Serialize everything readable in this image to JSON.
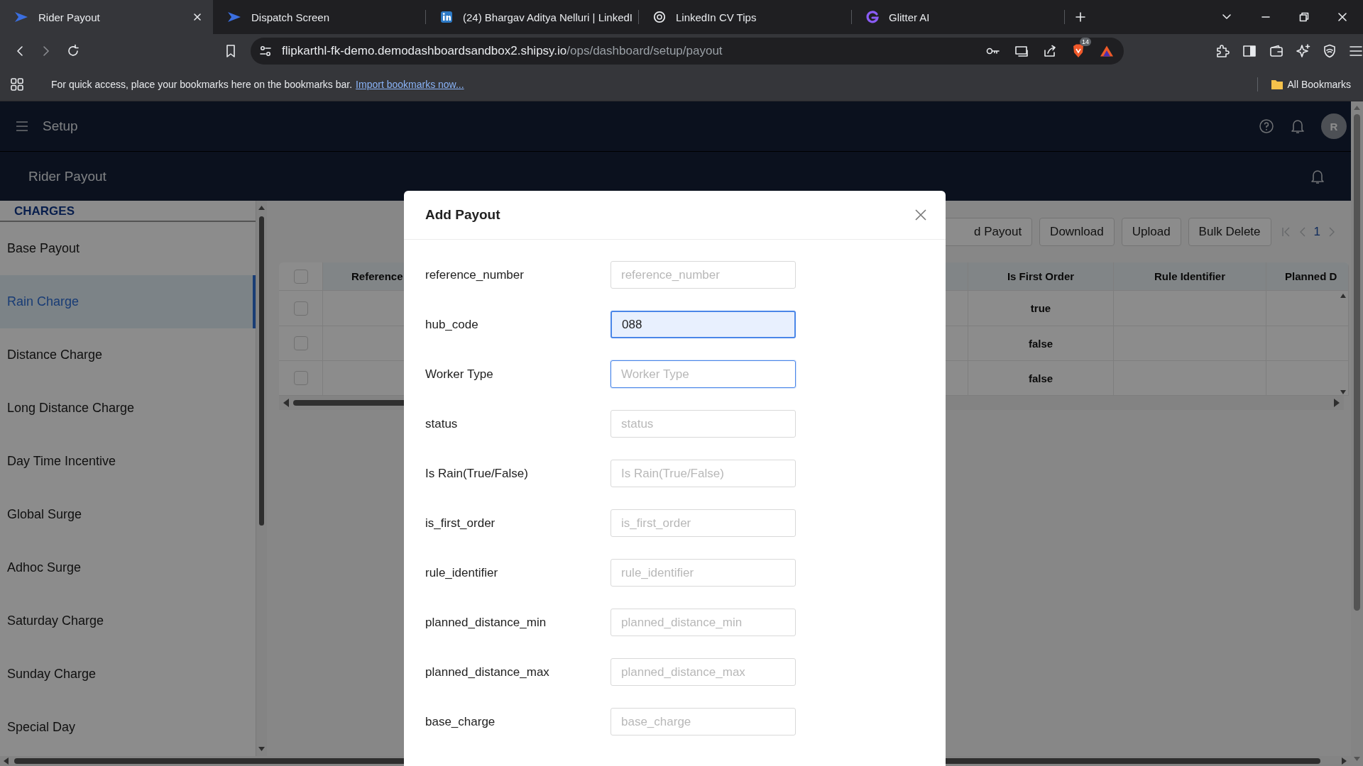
{
  "browser": {
    "tabs": [
      {
        "title": "Rider Payout",
        "kind": "shipsy",
        "selected": true
      },
      {
        "title": "Dispatch Screen",
        "kind": "shipsy",
        "selected": false
      },
      {
        "title": "(24) Bhargav Aditya Nelluri | LinkedI",
        "kind": "linkedin",
        "selected": false
      },
      {
        "title": "LinkedIn CV Tips",
        "kind": "globe",
        "selected": false
      },
      {
        "title": "Glitter AI",
        "kind": "glitter",
        "selected": false
      }
    ],
    "url": {
      "host": "flipkarthl-fk-demo.demodashboardsandbox2.shipsy.io",
      "path": "/ops/dashboard/setup/payout"
    },
    "extension_badge": "14",
    "bookmarks_bar": {
      "message": "For quick access, place your bookmarks here on the bookmarks bar.",
      "link": "Import bookmarks now...",
      "all_bookmarks": "All Bookmarks"
    }
  },
  "app": {
    "header_title": "Setup",
    "avatar": "R",
    "page_title": "Rider Payout"
  },
  "sidebar": {
    "heading": "CHARGES",
    "items": [
      {
        "label": "Base Payout",
        "selected": false
      },
      {
        "label": "Rain Charge",
        "selected": true
      },
      {
        "label": "Distance Charge",
        "selected": false
      },
      {
        "label": "Long Distance Charge",
        "selected": false
      },
      {
        "label": "Day Time Incentive",
        "selected": false
      },
      {
        "label": "Global Surge",
        "selected": false
      },
      {
        "label": "Adhoc Surge",
        "selected": false
      },
      {
        "label": "Saturday Charge",
        "selected": false
      },
      {
        "label": "Sunday Charge",
        "selected": false
      },
      {
        "label": "Special Day",
        "selected": false
      }
    ]
  },
  "toolbar": {
    "buttons": [
      "d Payout",
      "Download",
      "Upload",
      "Bulk Delete"
    ],
    "page": "1"
  },
  "table": {
    "header_checked": false,
    "columns": [
      "Reference",
      "Is First Order",
      "Rule Identifier",
      "Planned D"
    ],
    "rows": [
      {
        "checked": false,
        "is_first_order": "true"
      },
      {
        "checked": false,
        "is_first_order": "false"
      },
      {
        "checked": false,
        "is_first_order": "false"
      }
    ]
  },
  "modal": {
    "title": "Add Payout",
    "fields": [
      {
        "label": "reference_number",
        "placeholder": "reference_number",
        "focused": false,
        "autofilled": false
      },
      {
        "label": "hub_code",
        "value": "088",
        "focused": false,
        "autofilled": true
      },
      {
        "label": "Worker Type",
        "placeholder": "Worker Type",
        "focused": true,
        "autofilled": false
      },
      {
        "label": "status",
        "placeholder": "status",
        "focused": false,
        "autofilled": false
      },
      {
        "label": "Is Rain(True/False)",
        "placeholder": "Is Rain(True/False)",
        "focused": false,
        "autofilled": false
      },
      {
        "label": "is_first_order",
        "placeholder": "is_first_order",
        "focused": false,
        "autofilled": false
      },
      {
        "label": "rule_identifier",
        "placeholder": "rule_identifier",
        "focused": false,
        "autofilled": false
      },
      {
        "label": "planned_distance_min",
        "placeholder": "planned_distance_min",
        "focused": false,
        "autofilled": false
      },
      {
        "label": "planned_distance_max",
        "placeholder": "planned_distance_max",
        "focused": false,
        "autofilled": false
      },
      {
        "label": "base_charge",
        "placeholder": "base_charge",
        "focused": false,
        "autofilled": false
      }
    ]
  }
}
